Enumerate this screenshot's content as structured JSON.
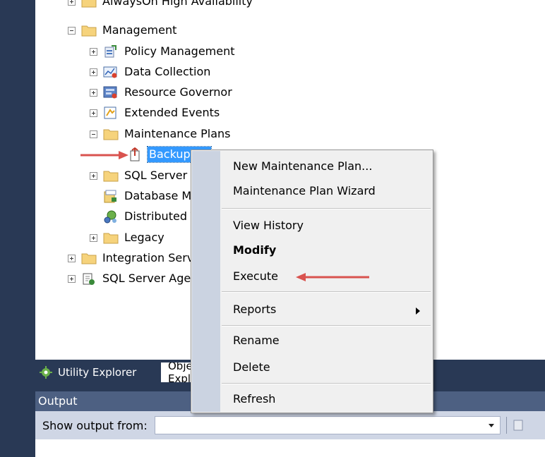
{
  "tree": {
    "items": [
      {
        "label": "AlwaysOn High Availability"
      },
      {
        "label": "Management"
      },
      {
        "label": "Policy Management"
      },
      {
        "label": "Data Collection"
      },
      {
        "label": "Resource Governor"
      },
      {
        "label": "Extended Events"
      },
      {
        "label": "Maintenance Plans"
      },
      {
        "label": "BackupFull"
      },
      {
        "label": "SQL Server Logs"
      },
      {
        "label": "Database Mail"
      },
      {
        "label": "Distributed Transaction Coordinator"
      },
      {
        "label": "Legacy"
      },
      {
        "label": "Integration Services Catalogs"
      },
      {
        "label": "SQL Server Agent"
      }
    ]
  },
  "context_menu": {
    "items": [
      {
        "label": "New Maintenance Plan..."
      },
      {
        "label": "Maintenance Plan Wizard"
      },
      {
        "label": "View History"
      },
      {
        "label": "Modify"
      },
      {
        "label": "Execute"
      },
      {
        "label": "Reports"
      },
      {
        "label": "Rename"
      },
      {
        "label": "Delete"
      },
      {
        "label": "Refresh"
      }
    ]
  },
  "tabs": [
    {
      "label": "Utility Explorer"
    },
    {
      "label": "Object Explorer"
    }
  ],
  "output": {
    "title": "Output",
    "show_from_label": "Show output from:",
    "show_from_value": ""
  },
  "colors": {
    "annotation_arrow": "#d9534f",
    "selection": "#3399ff",
    "ide_background": "#293955",
    "output_header": "#4d6082"
  },
  "icons": {
    "folder": "folder-icon",
    "policy": "policy-management-icon",
    "data_collection": "data-collection-icon",
    "resource_governor": "resource-governor-icon",
    "extended_events": "extended-events-icon",
    "maintenance_plan": "maintenance-plan-icon",
    "database_mail": "database-mail-icon",
    "dtc": "dtc-icon",
    "agent": "sql-agent-icon"
  }
}
